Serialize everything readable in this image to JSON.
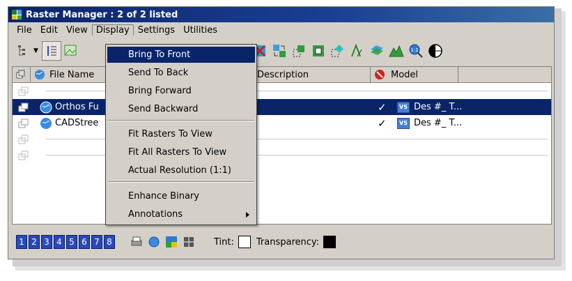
{
  "window": {
    "title": "Raster Manager : 2 of 2 listed"
  },
  "menubar": [
    "File",
    "Edit",
    "View",
    "Display",
    "Settings",
    "Utilities"
  ],
  "columns": {
    "file_name": "File Name",
    "description": "Description",
    "model": "Model"
  },
  "rows": [
    {
      "file_name": "Orthos Fu",
      "checked": "✓",
      "model": "Des #_ T...",
      "model_icon": "VS"
    },
    {
      "file_name": "CADStree",
      "checked": "✓",
      "model": "Des #_ T...",
      "model_icon": "VS"
    }
  ],
  "display_menu": {
    "items": [
      "Bring To Front",
      "Send To Back",
      "Bring Forward",
      "Send Backward",
      "Fit Rasters To View",
      "Fit All Rasters To View",
      "Actual Resolution (1:1)",
      "Enhance Binary",
      "Annotations"
    ],
    "highlighted": "Bring To Front"
  },
  "statusbar": {
    "views": [
      "1",
      "2",
      "3",
      "4",
      "5",
      "6",
      "7",
      "8"
    ],
    "tint_label": "Tint:",
    "transparency_label": "Transparency:"
  },
  "colors": {
    "title_bar": "#0a246a",
    "selection": "#0a246a",
    "chrome": "#d4d0c8"
  }
}
